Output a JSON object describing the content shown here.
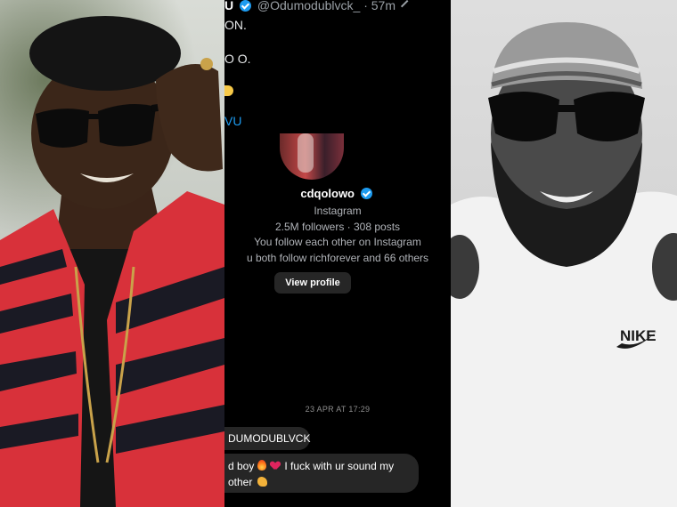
{
  "tweet": {
    "name_partial": "U",
    "handle": "@Odumodublvck_",
    "separator": "·",
    "time": "57m",
    "lines": [
      "ON.",
      "O O."
    ],
    "link_partial": "VU"
  },
  "instagram_card": {
    "username": "cdqolowo",
    "platform": "Instagram",
    "stats": "2.5M followers · 308 posts",
    "mutual_follow": "You follow each other on Instagram",
    "mutual_followers": "u both follow richforever and 66 others",
    "view_profile_label": "View profile"
  },
  "chat": {
    "date_stamp": "23 APR AT 17:29",
    "messages": [
      {
        "text": "DUMODUBLVCK"
      },
      {
        "text_a": "d boy",
        "text_b": "I fuck with ur sound my",
        "text_c": "other"
      }
    ]
  },
  "icons": [
    "verified-badge-icon",
    "edit-icon",
    "flame-emoji-icon",
    "heart-emoji-icon",
    "flexed-biceps-emoji-icon",
    "laughing-emoji-icon"
  ],
  "colors": {
    "verified_blue": "#1d9bf0",
    "bubble_bg": "#262626",
    "panel_bg": "#000000"
  }
}
